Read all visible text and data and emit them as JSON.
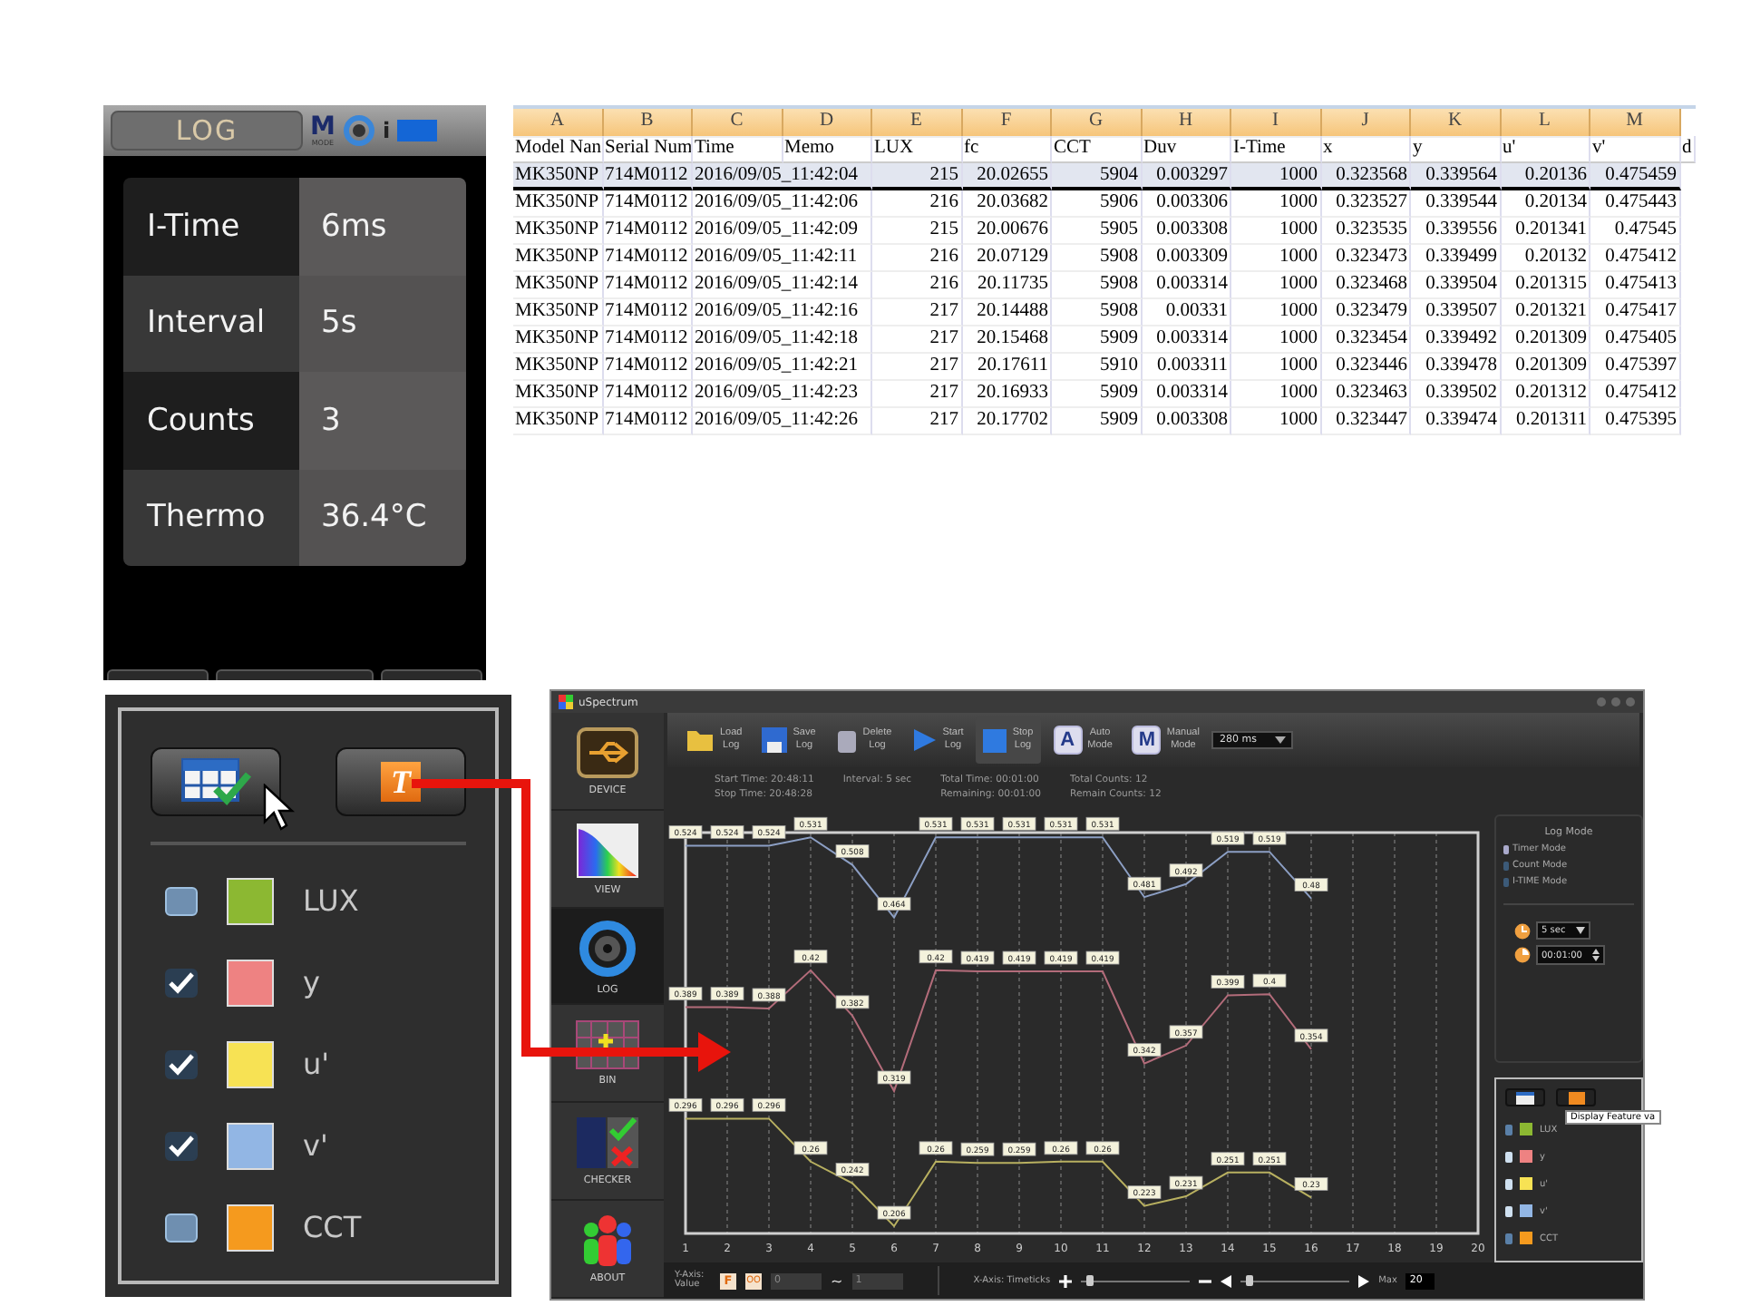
{
  "device_screen": {
    "title": "LOG",
    "mode_letter": "M",
    "mode_caption": "MODE",
    "info_mark": "i",
    "rows": [
      {
        "label": "I-Time",
        "value": "6ms"
      },
      {
        "label": "Interval",
        "value": "5s"
      },
      {
        "label": "Counts",
        "value": "3"
      },
      {
        "label": "Thermo",
        "value": "36.4°C"
      }
    ]
  },
  "spreadsheet": {
    "column_letters": [
      "A",
      "B",
      "C",
      "D",
      "E",
      "F",
      "G",
      "H",
      "I",
      "J",
      "K",
      "L",
      "M"
    ],
    "headers": [
      "Model Nan",
      "Serial Num",
      "Time",
      "Memo",
      "LUX",
      "fc",
      "CCT",
      "Duv",
      "I-Time",
      "x",
      "y",
      "u'",
      "v'",
      "d"
    ],
    "rows": [
      {
        "selected": true,
        "cells": [
          "MK350NP",
          "714M0112",
          "2016/09/05_11:42:04",
          "215",
          "20.02655",
          "5904",
          "0.003297",
          "1000",
          "0.323568",
          "0.339564",
          "0.20136",
          "0.475459"
        ]
      },
      {
        "selected": false,
        "cells": [
          "MK350NP",
          "714M0112",
          "2016/09/05_11:42:06",
          "216",
          "20.03682",
          "5906",
          "0.003306",
          "1000",
          "0.323527",
          "0.339544",
          "0.20134",
          "0.475443"
        ]
      },
      {
        "selected": false,
        "cells": [
          "MK350NP",
          "714M0112",
          "2016/09/05_11:42:09",
          "215",
          "20.00676",
          "5905",
          "0.003308",
          "1000",
          "0.323535",
          "0.339556",
          "0.201341",
          "0.47545"
        ]
      },
      {
        "selected": false,
        "cells": [
          "MK350NP",
          "714M0112",
          "2016/09/05_11:42:11",
          "216",
          "20.07129",
          "5908",
          "0.003309",
          "1000",
          "0.323473",
          "0.339499",
          "0.20132",
          "0.475412"
        ]
      },
      {
        "selected": false,
        "cells": [
          "MK350NP",
          "714M0112",
          "2016/09/05_11:42:14",
          "216",
          "20.11735",
          "5908",
          "0.003314",
          "1000",
          "0.323468",
          "0.339504",
          "0.201315",
          "0.475413"
        ]
      },
      {
        "selected": false,
        "cells": [
          "MK350NP",
          "714M0112",
          "2016/09/05_11:42:16",
          "217",
          "20.14488",
          "5908",
          "0.00331",
          "1000",
          "0.323479",
          "0.339507",
          "0.201321",
          "0.475417"
        ]
      },
      {
        "selected": false,
        "cells": [
          "MK350NP",
          "714M0112",
          "2016/09/05_11:42:18",
          "217",
          "20.15468",
          "5909",
          "0.003314",
          "1000",
          "0.323454",
          "0.339492",
          "0.201309",
          "0.475405"
        ]
      },
      {
        "selected": false,
        "cells": [
          "MK350NP",
          "714M0112",
          "2016/09/05_11:42:21",
          "217",
          "20.17611",
          "5910",
          "0.003311",
          "1000",
          "0.323446",
          "0.339478",
          "0.201309",
          "0.475397"
        ]
      },
      {
        "selected": false,
        "cells": [
          "MK350NP",
          "714M0112",
          "2016/09/05_11:42:23",
          "217",
          "20.16933",
          "5909",
          "0.003314",
          "1000",
          "0.323463",
          "0.339502",
          "0.201312",
          "0.475412"
        ]
      },
      {
        "selected": false,
        "cells": [
          "MK350NP",
          "714M0112",
          "2016/09/05_11:42:26",
          "217",
          "20.17702",
          "5909",
          "0.003308",
          "1000",
          "0.323447",
          "0.339474",
          "0.201311",
          "0.475395"
        ]
      }
    ]
  },
  "feature_panel": {
    "display_letter": "T",
    "items": [
      {
        "label": "LUX",
        "checked": false,
        "color": "#8cb832"
      },
      {
        "label": "y",
        "checked": true,
        "color": "#ee8282"
      },
      {
        "label": "u'",
        "checked": true,
        "color": "#f7e254"
      },
      {
        "label": "v'",
        "checked": true,
        "color": "#92b6e4"
      },
      {
        "label": "CCT",
        "checked": false,
        "color": "#f59a1e"
      }
    ]
  },
  "app_window": {
    "title": "uSpectrum",
    "nav": [
      {
        "kind": "device",
        "label": "DEVICE",
        "selected": false
      },
      {
        "kind": "view",
        "label": "VIEW",
        "selected": false
      },
      {
        "kind": "log",
        "label": "LOG",
        "selected": true
      },
      {
        "kind": "bin",
        "label": "BIN",
        "selected": false
      },
      {
        "kind": "checker",
        "label": "CHECKER",
        "selected": false
      },
      {
        "kind": "about",
        "label": "ABOUT",
        "selected": false
      }
    ],
    "toolbar": [
      {
        "kind": "load",
        "line1": "Load",
        "line2": "Log",
        "selected": false
      },
      {
        "kind": "save",
        "line1": "Save",
        "line2": "Log",
        "selected": false
      },
      {
        "kind": "delete",
        "line1": "Delete",
        "line2": "Log",
        "selected": false
      },
      {
        "kind": "start",
        "line1": "Start",
        "line2": "Log",
        "selected": false
      },
      {
        "kind": "stop",
        "line1": "Stop",
        "line2": "Log",
        "selected": true
      },
      {
        "kind": "auto",
        "glyph": "A",
        "line1": "Auto",
        "line2": "Mode",
        "selected": false
      },
      {
        "kind": "manual",
        "glyph": "M",
        "line1": "Manual",
        "line2": "Mode",
        "selected": false
      }
    ],
    "integration_time": "280 ms",
    "status": [
      {
        "label": "Start Time:",
        "value": "20:48:11"
      },
      {
        "label": "Stop Time:",
        "value": "20:48:28"
      },
      {
        "label": "Interval:",
        "value": "5 sec"
      },
      {
        "label": "Total Time:",
        "value": "00:01:00"
      },
      {
        "label": "Remaining:",
        "value": "00:01:00"
      },
      {
        "label": "Total Counts:",
        "value": "12"
      },
      {
        "label": "Remain Counts:",
        "value": "12"
      }
    ],
    "chart_data": {
      "type": "line",
      "x": [
        1,
        2,
        3,
        4,
        5,
        6,
        7,
        8,
        9,
        10,
        11,
        12,
        13,
        14,
        15,
        16
      ],
      "xlim": [
        1,
        20
      ],
      "xticks": [
        1,
        2,
        3,
        4,
        5,
        6,
        7,
        8,
        9,
        10,
        11,
        12,
        13,
        14,
        15,
        16,
        17,
        18,
        19,
        20
      ],
      "grid": true,
      "data_labels": true,
      "series": [
        {
          "color": "#8c9fc4",
          "values": [
            0.524,
            0.524,
            0.524,
            0.531,
            0.508,
            0.464,
            0.531,
            0.531,
            0.531,
            0.531,
            0.531,
            0.481,
            0.492,
            0.519,
            0.519,
            0.48
          ]
        },
        {
          "color": "#b36c7a",
          "values": [
            0.389,
            0.389,
            0.388,
            0.42,
            0.382,
            0.319,
            0.42,
            0.419,
            0.419,
            0.419,
            0.419,
            0.342,
            0.357,
            0.399,
            0.4,
            0.354
          ]
        },
        {
          "color": "#b8b060",
          "values": [
            0.296,
            0.296,
            0.296,
            0.26,
            0.242,
            0.206,
            0.26,
            0.259,
            0.259,
            0.26,
            0.26,
            0.223,
            0.231,
            0.251,
            0.251,
            0.23
          ]
        }
      ]
    },
    "log_mode": {
      "title": "Log Mode",
      "options": [
        {
          "label": "Timer Mode",
          "selected": true
        },
        {
          "label": "Count Mode",
          "selected": false
        },
        {
          "label": "I-TIME Mode",
          "selected": false
        }
      ],
      "interval": "5 sec",
      "duration": "00:01:00"
    },
    "legend": {
      "tooltip": "Display Feature va",
      "items": [
        {
          "label": "LUX",
          "checked": false,
          "color": "#8cb832"
        },
        {
          "label": "y",
          "checked": true,
          "color": "#ee8282"
        },
        {
          "label": "u'",
          "checked": true,
          "color": "#f7e254"
        },
        {
          "label": "v'",
          "checked": true,
          "color": "#92b6e4"
        },
        {
          "label": "CCT",
          "checked": false,
          "color": "#f59a1e"
        }
      ]
    },
    "bottom_bar": {
      "y_axis_label": "Y-Axis: Value",
      "y_letter": "F",
      "y_alt": "OO",
      "y_min": "0",
      "range_separator": "~",
      "y_max": "1",
      "x_axis_label": "X-Axis: Timeticks",
      "zoom_slider": {
        "level": 0.05
      },
      "scroll_slider": {
        "level": 0.05
      },
      "max_label": "Max",
      "max_value": "20"
    }
  }
}
